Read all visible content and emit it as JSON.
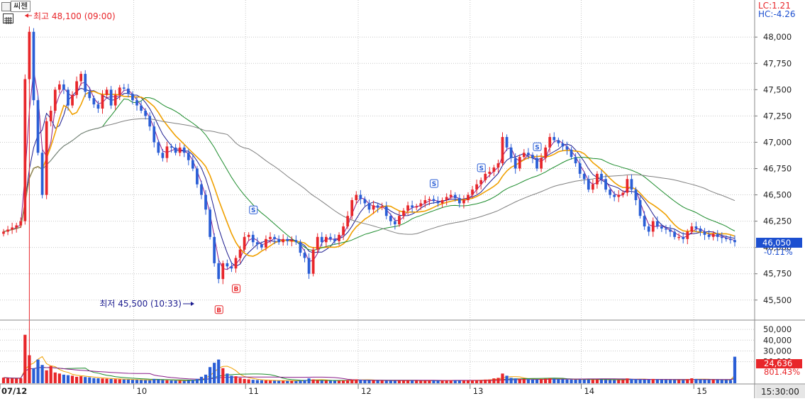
{
  "header": {
    "stock_name": "씨젠"
  },
  "info": {
    "lc": "LC:1.21",
    "hc": "HC:-4.26"
  },
  "annotations": {
    "high": {
      "label": "최고 48,100 (09:00)",
      "value": 48100
    },
    "low": {
      "label": "최저 45,500 (10:33)",
      "value": 45500
    }
  },
  "current": {
    "price": "46,050",
    "change": "-0.11%",
    "volume": "24,636",
    "volume_pct": "801.43%"
  },
  "time_label": "15:30:00",
  "colors": {
    "up": "#e8262a",
    "down": "#2a5ed6",
    "ma5": "#8a1d8a",
    "ma10": "#1c1c8f",
    "ma20": "#f0a000",
    "ma60": "#1c8c2c",
    "ma120": "#808080"
  },
  "chart_data": {
    "type": "candlestick",
    "price_axis": {
      "ylim": [
        45350,
        48150
      ],
      "ticks": [
        "48,000",
        "47,750",
        "47,500",
        "47,250",
        "47,000",
        "46,750",
        "46,500",
        "46,250",
        "46,000",
        "45,750",
        "45,500"
      ]
    },
    "volume_axis": {
      "ylim": [
        0,
        56000
      ],
      "ticks": [
        "50,000",
        "40,000",
        "30,000",
        "20,000"
      ]
    },
    "x_labels": [
      "07/12",
      "10",
      "11",
      "12",
      "13",
      "14",
      "15"
    ],
    "close": [
      46150,
      46170,
      46190,
      46210,
      46250,
      47600,
      48050,
      47400,
      46900,
      46500,
      47200,
      47300,
      47500,
      47550,
      47500,
      47350,
      47450,
      47580,
      47650,
      47480,
      47420,
      47360,
      47320,
      47450,
      47500,
      47350,
      47450,
      47520,
      47510,
      47460,
      47400,
      47350,
      47300,
      47250,
      47150,
      47000,
      46900,
      46850,
      46960,
      46950,
      46900,
      46950,
      46900,
      46830,
      46750,
      46600,
      46500,
      46360,
      46100,
      45850,
      45700,
      45850,
      45820,
      45800,
      45900,
      45980,
      46100,
      46120,
      46050,
      46030,
      46000,
      46080,
      46100,
      46080,
      46050,
      46080,
      46060,
      46070,
      46050,
      45950,
      45900,
      45750,
      45980,
      46100,
      46050,
      46100,
      46080,
      46060,
      46120,
      46200,
      46300,
      46450,
      46500,
      46460,
      46420,
      46360,
      46400,
      46380,
      46390,
      46300,
      46250,
      46220,
      46300,
      46350,
      46400,
      46380,
      46390,
      46420,
      46450,
      46460,
      46440,
      46420,
      46450,
      46480,
      46500,
      46470,
      46420,
      46450,
      46500,
      46550,
      46600,
      46640,
      46700,
      46720,
      46760,
      46800,
      47050,
      46950,
      46850,
      46750,
      46860,
      46900,
      46880,
      46850,
      46750,
      46850,
      46950,
      47050,
      47020,
      46990,
      46960,
      46930,
      46860,
      46800,
      46700,
      46650,
      46550,
      46600,
      46700,
      46650,
      46550,
      46500,
      46480,
      46500,
      46520,
      46650,
      46550,
      46450,
      46300,
      46200,
      46150,
      46250,
      46200,
      46180,
      46170,
      46150,
      46100,
      46100,
      46080,
      46150,
      46200,
      46180,
      46150,
      46120,
      46100,
      46130,
      46100,
      46090,
      46080,
      46070,
      46050
    ],
    "volume": [
      5200,
      4800,
      4500,
      4300,
      4600,
      45000,
      26000,
      14000,
      22000,
      17000,
      12000,
      16000,
      10000,
      9000,
      8000,
      7500,
      7000,
      6000,
      6500,
      5800,
      5500,
      4800,
      4600,
      4400,
      4200,
      4000,
      3800,
      3600,
      3500,
      3400,
      3200,
      3100,
      3000,
      2900,
      2800,
      4000,
      3500,
      3000,
      2800,
      2600,
      2500,
      2400,
      2300,
      2600,
      3000,
      4000,
      6000,
      8000,
      15000,
      19000,
      22000,
      14000,
      9000,
      7000,
      6500,
      5000,
      4000,
      3600,
      3200,
      3000,
      2800,
      2600,
      2500,
      2400,
      2300,
      2300,
      2200,
      2200,
      2100,
      2500,
      3000,
      4500,
      3500,
      2800,
      2600,
      2500,
      2400,
      2300,
      2400,
      2600,
      3000,
      3400,
      3600,
      3200,
      3000,
      2800,
      2700,
      2600,
      2500,
      2400,
      2400,
      2300,
      2500,
      2600,
      2700,
      2600,
      2500,
      2500,
      2600,
      2700,
      2600,
      2500,
      2600,
      2700,
      2800,
      2600,
      2500,
      2600,
      2700,
      2800,
      2900,
      3000,
      3400,
      3500,
      4500,
      5000,
      9000,
      7000,
      5000,
      4500,
      4200,
      4000,
      3800,
      3600,
      3500,
      3800,
      4200,
      4600,
      4200,
      3900,
      3700,
      3500,
      3400,
      3300,
      3500,
      3400,
      3300,
      3200,
      3400,
      3300,
      3200,
      3100,
      3000,
      3100,
      3200,
      4500,
      4000,
      3800,
      3600,
      3400,
      3300,
      4000,
      3500,
      3300,
      3200,
      3100,
      3000,
      3000,
      2900,
      3800,
      4600,
      4000,
      3500,
      3300,
      3200,
      3300,
      3200,
      3100,
      3000,
      3000,
      24636
    ]
  }
}
